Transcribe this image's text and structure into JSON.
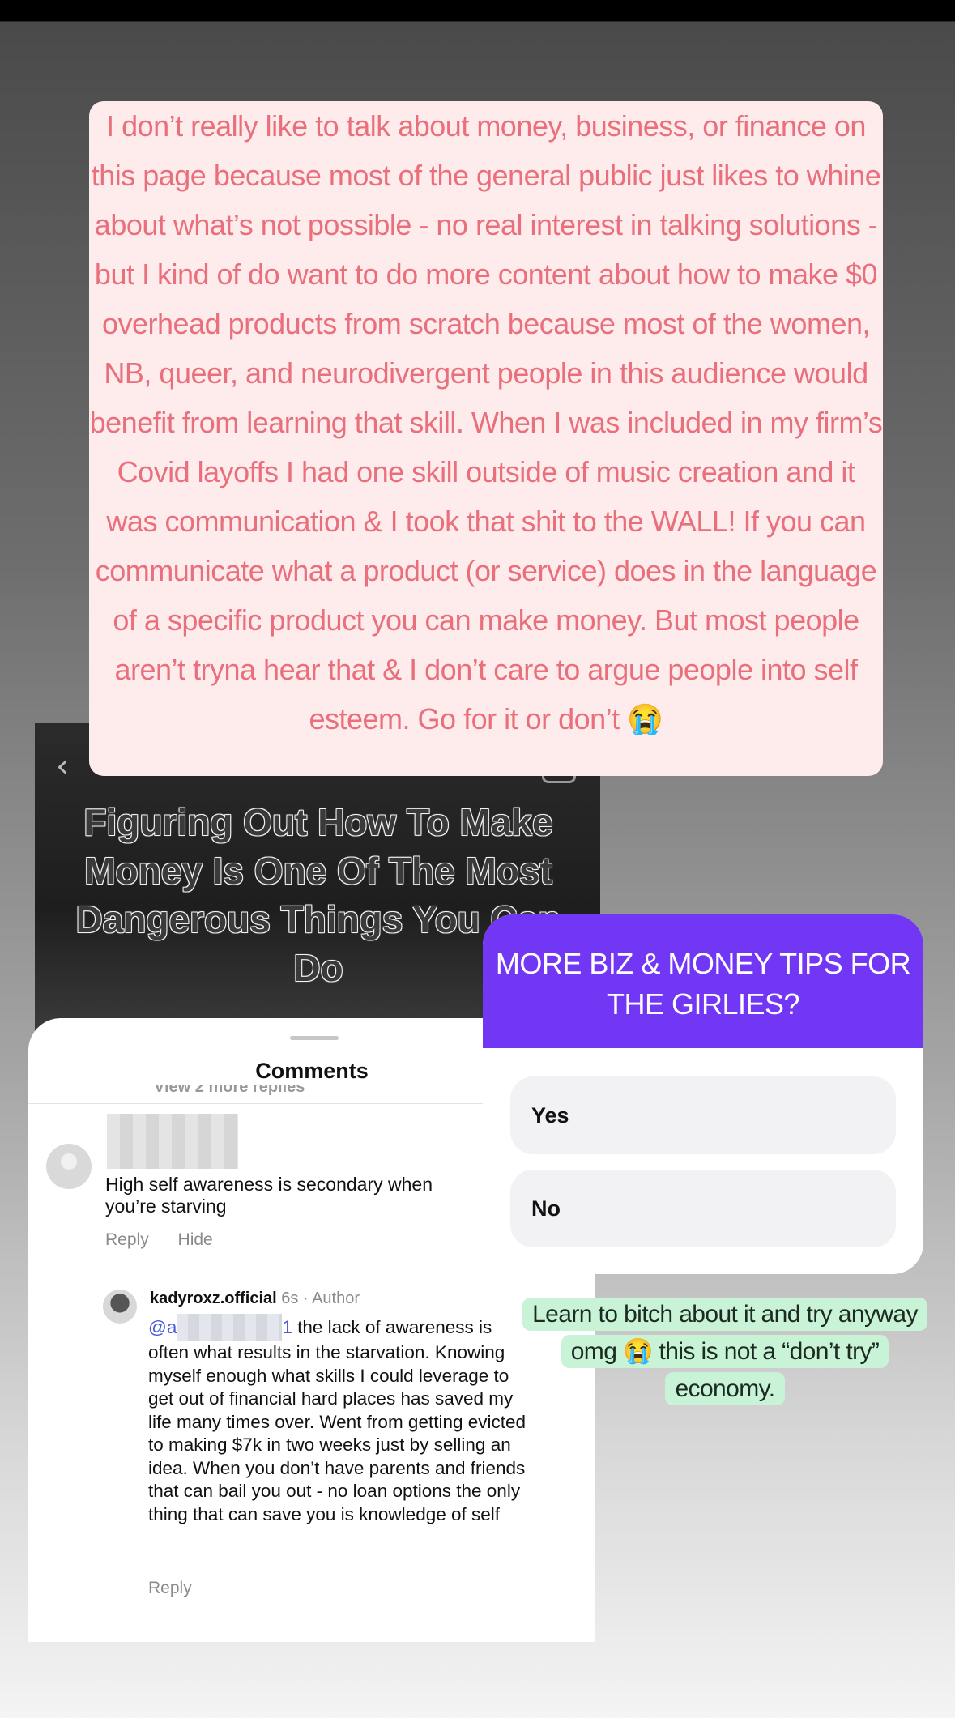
{
  "story": {
    "text": "I don’t really like to talk about money, business, or finance on this page because most of the general public just likes to whine about what’s not possible - no real interest in talking solutions - but I kind of do want to do more content about how to make $0 overhead products from scratch because most of the women, NB, queer, and neurodivergent people in this audience  would benefit from learning that skill. When I was included in my firm’s Covid layoffs I had one skill outside of music creation and it was communication & I took that shit to the WALL! If you can communicate what a product (or service) does in the language of a specific product you can make money. But most people aren’t tryna hear that & I don’t care to argue people into self esteem. Go for it or don’t 😭"
  },
  "reel": {
    "caption": "Figuring Out How To Make Money Is One Of The Most Dangerous Things You Can Do",
    "back_icon": "chevron-left-icon",
    "camera_icon": "camera-icon"
  },
  "comments": {
    "title": "Comments",
    "view_more": "View 2 more replies",
    "first": {
      "text": "High self awareness is secondary when you’re starving",
      "reply": "Reply",
      "hide": "Hide"
    },
    "second": {
      "author": "kadyroxz.official",
      "meta": "6s · Author",
      "mention_start": "@a",
      "mention_end": "1",
      "text": " the lack of awareness is often what results in the starvation. Knowing myself enough what skills I could leverage to get out of financial hard places has saved my life many times over. Went from getting evicted to making $7k in two weeks just by selling an idea. When you don’t have parents and friends that can bail you out - no loan options the only thing that can save you is knowledge of self",
      "reply": "Reply"
    }
  },
  "poll": {
    "question": "MORE BIZ & MONEY TIPS FOR THE GIRLIES?",
    "options": [
      "Yes",
      "No"
    ],
    "accent": "#7237f4"
  },
  "reply_bubble": {
    "text": "Learn to bitch about it and try anyway omg 😭 this is not a “don’t try” economy."
  },
  "colors": {
    "story_text": "#ea6f7c",
    "story_bg": "#fdeceb",
    "reply_bg": "#c8f3d7"
  }
}
